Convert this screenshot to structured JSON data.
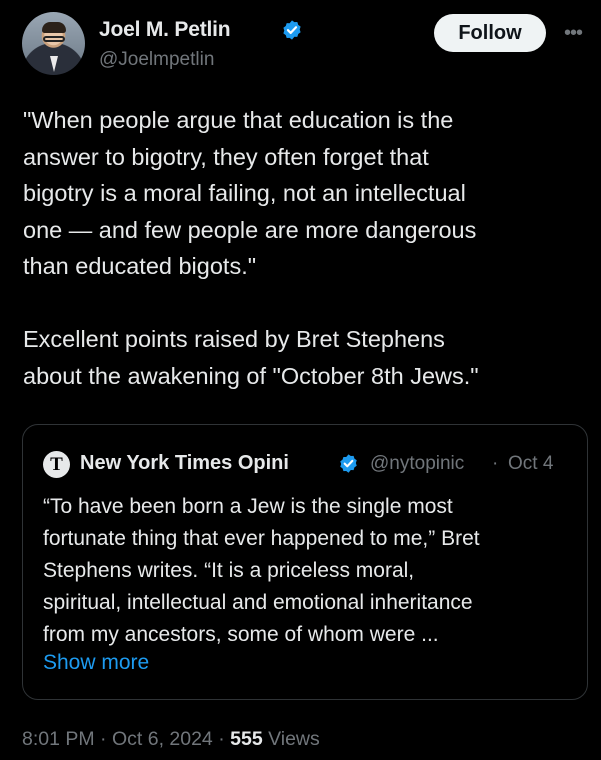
{
  "author": {
    "display_name": "Joel M. Petlin",
    "handle": "@Joelmpetlin",
    "verified": true,
    "avatar": "profile-photo"
  },
  "actions": {
    "follow_label": "Follow",
    "more_label": "•••"
  },
  "tweet": {
    "lines": [
      "\"When people argue that education is the",
      "answer to bigotry, they often forget that",
      "bigotry is a moral failing, not an intellectual",
      "one — and few people are more dangerous",
      "than educated bigots.\"",
      "",
      "Excellent points raised by Bret Stephens",
      "about the awakening of \"October 8th Jews.\""
    ]
  },
  "quoted_tweet": {
    "logo_glyph": "T",
    "name": "New York Times Opini",
    "verified": true,
    "handle": "@nytopinic",
    "separator": "·",
    "date": "Oct 4",
    "lines": [
      "“To have been born a Jew is the single most",
      "fortunate thing that ever happened to me,” Bret",
      "Stephens writes. “It is a priceless moral,",
      "spiritual, intellectual and emotional inheritance",
      "from my ancestors, some of whom were ..."
    ],
    "show_more_label": "Show more"
  },
  "meta": {
    "time": "8:01 PM",
    "sep1": " · ",
    "date": "Oct 6, 2024",
    "sep2": " · ",
    "views_count": "555",
    "views_label": " Views"
  },
  "colors": {
    "background": "#000000",
    "text": "#e7e9ea",
    "secondary": "#71767b",
    "link": "#1d9bf0",
    "verified_badge": "#1d9bf0",
    "follow_bg": "#eff3f4"
  }
}
